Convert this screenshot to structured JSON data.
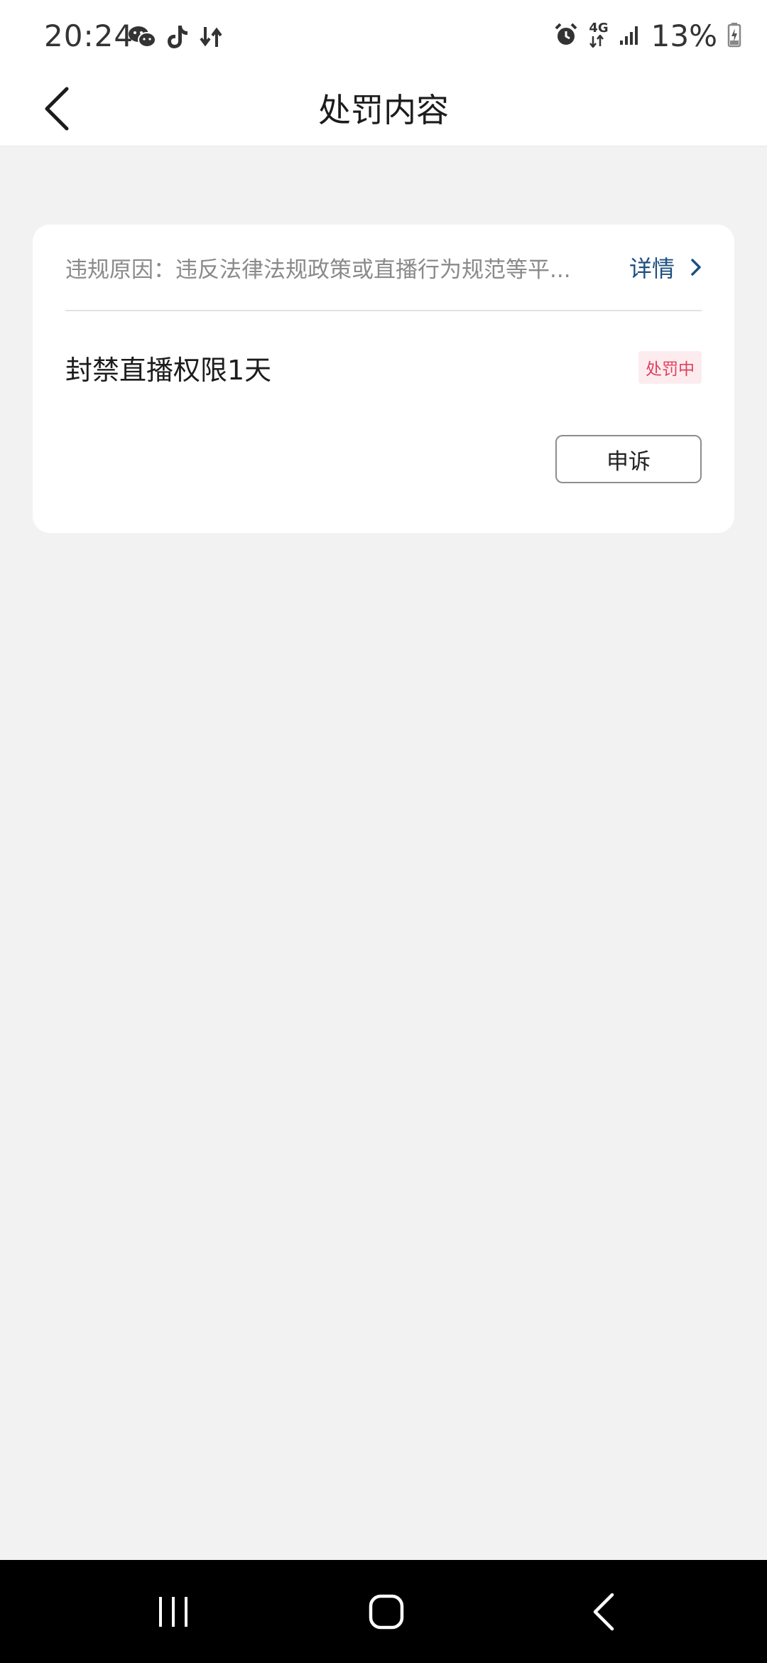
{
  "status_bar": {
    "time": "20:24",
    "network": "4G",
    "battery": "13%",
    "icons": [
      "wechat-icon",
      "tiktok-icon",
      "data-transfer-icon",
      "alarm-icon",
      "signal-icon",
      "battery-charging-icon"
    ]
  },
  "header": {
    "title": "处罚内容"
  },
  "card": {
    "reason": "违规原因：违反法律法规政策或直播行为规范等平...",
    "details_label": "详情",
    "penalty": "封禁直播权限1天",
    "status": "处罚中",
    "appeal_label": "申诉"
  },
  "colors": {
    "link": "#1e4f80",
    "status_text": "#e0405d",
    "status_bg": "#fdecef",
    "page_bg": "#f2f2f2"
  },
  "nav": {
    "icons": [
      "recent-apps-icon",
      "home-icon",
      "back-nav-icon"
    ]
  }
}
